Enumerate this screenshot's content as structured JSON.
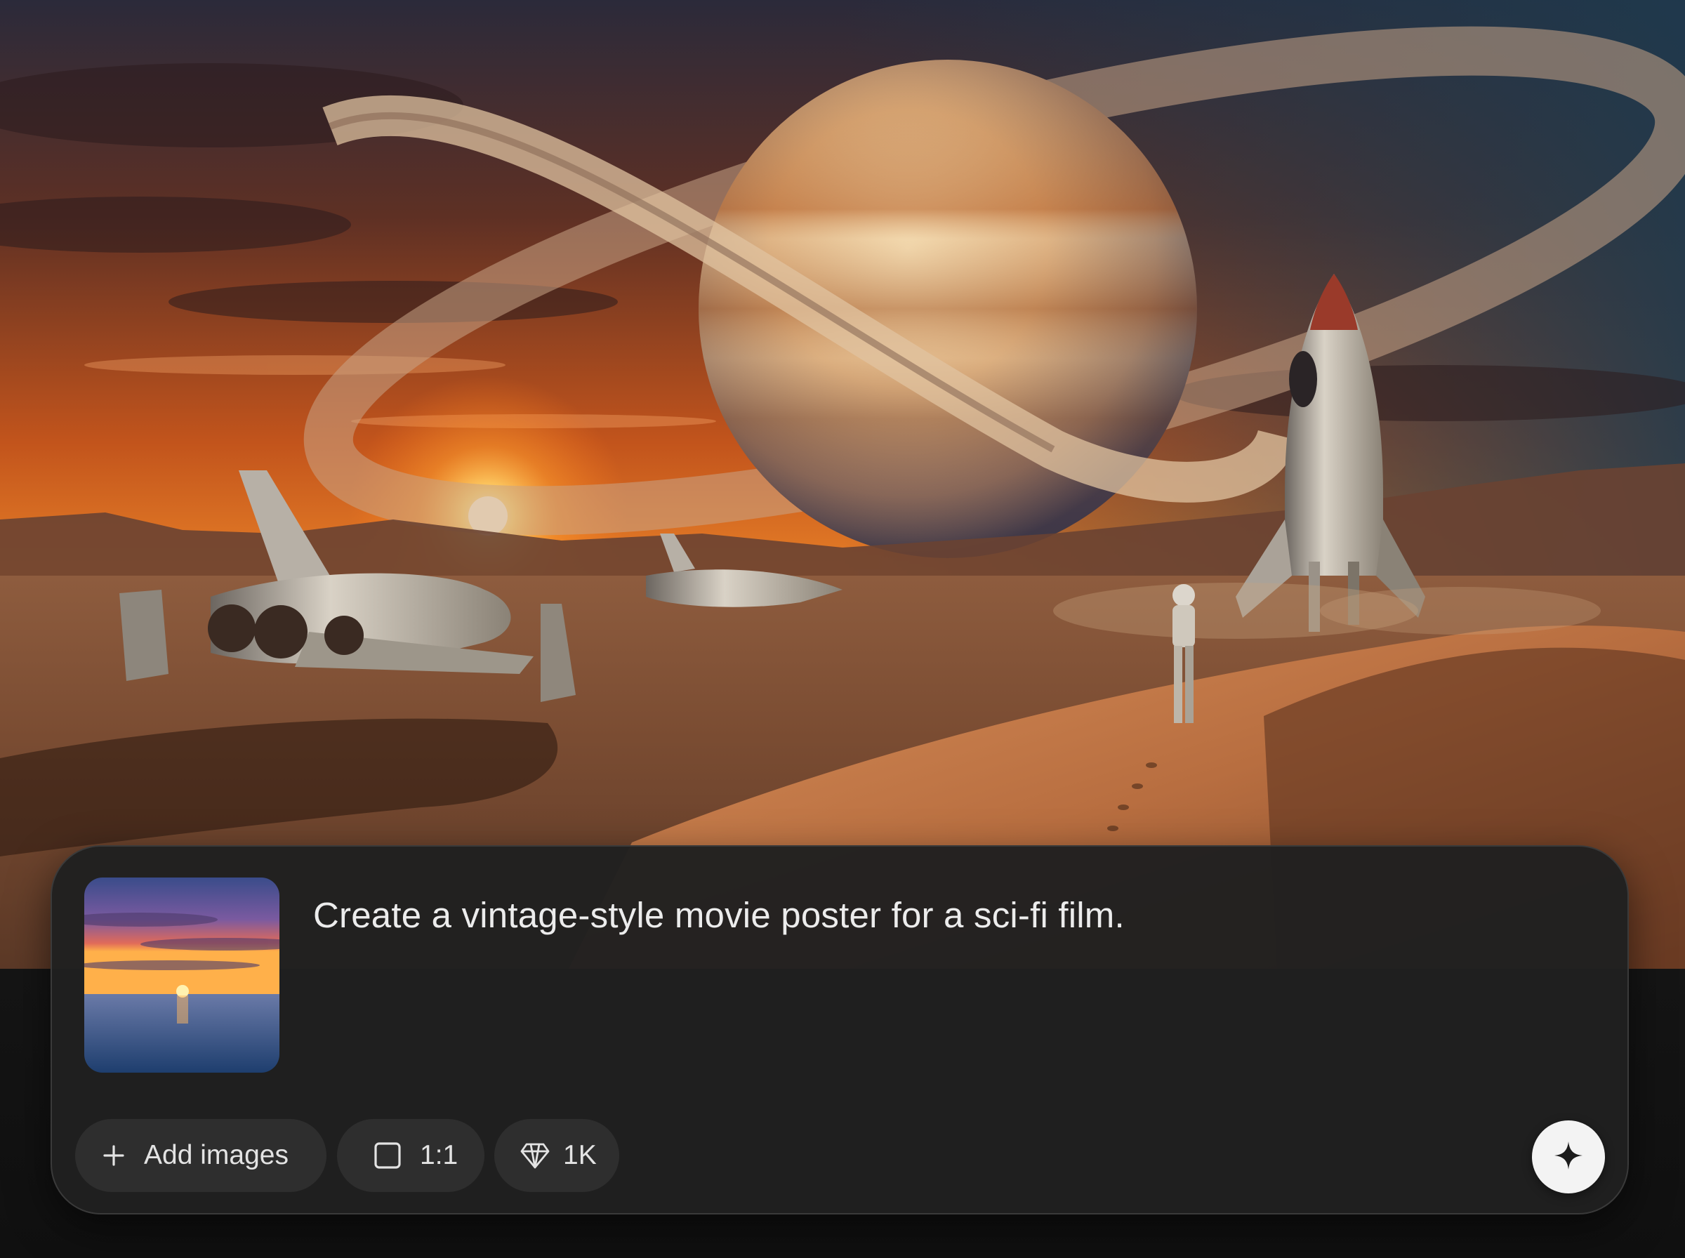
{
  "prompt": {
    "text": "Create a vintage-style movie poster for a sci-fi film."
  },
  "attachment": {
    "icon": "sunset-ocean-thumbnail"
  },
  "toolbar": {
    "add_images_label": "Add images",
    "aspect_ratio_label": "1:1",
    "resolution_label": "1K",
    "icons": {
      "add": "plus-icon",
      "ratio": "square-icon",
      "resolution": "diamond-icon",
      "submit": "sparkle-icon"
    }
  },
  "colors": {
    "card_background": "#202020",
    "chip_background": "#2e2e2e",
    "text": "#ececec",
    "submit_button": "#f3f3f3"
  }
}
